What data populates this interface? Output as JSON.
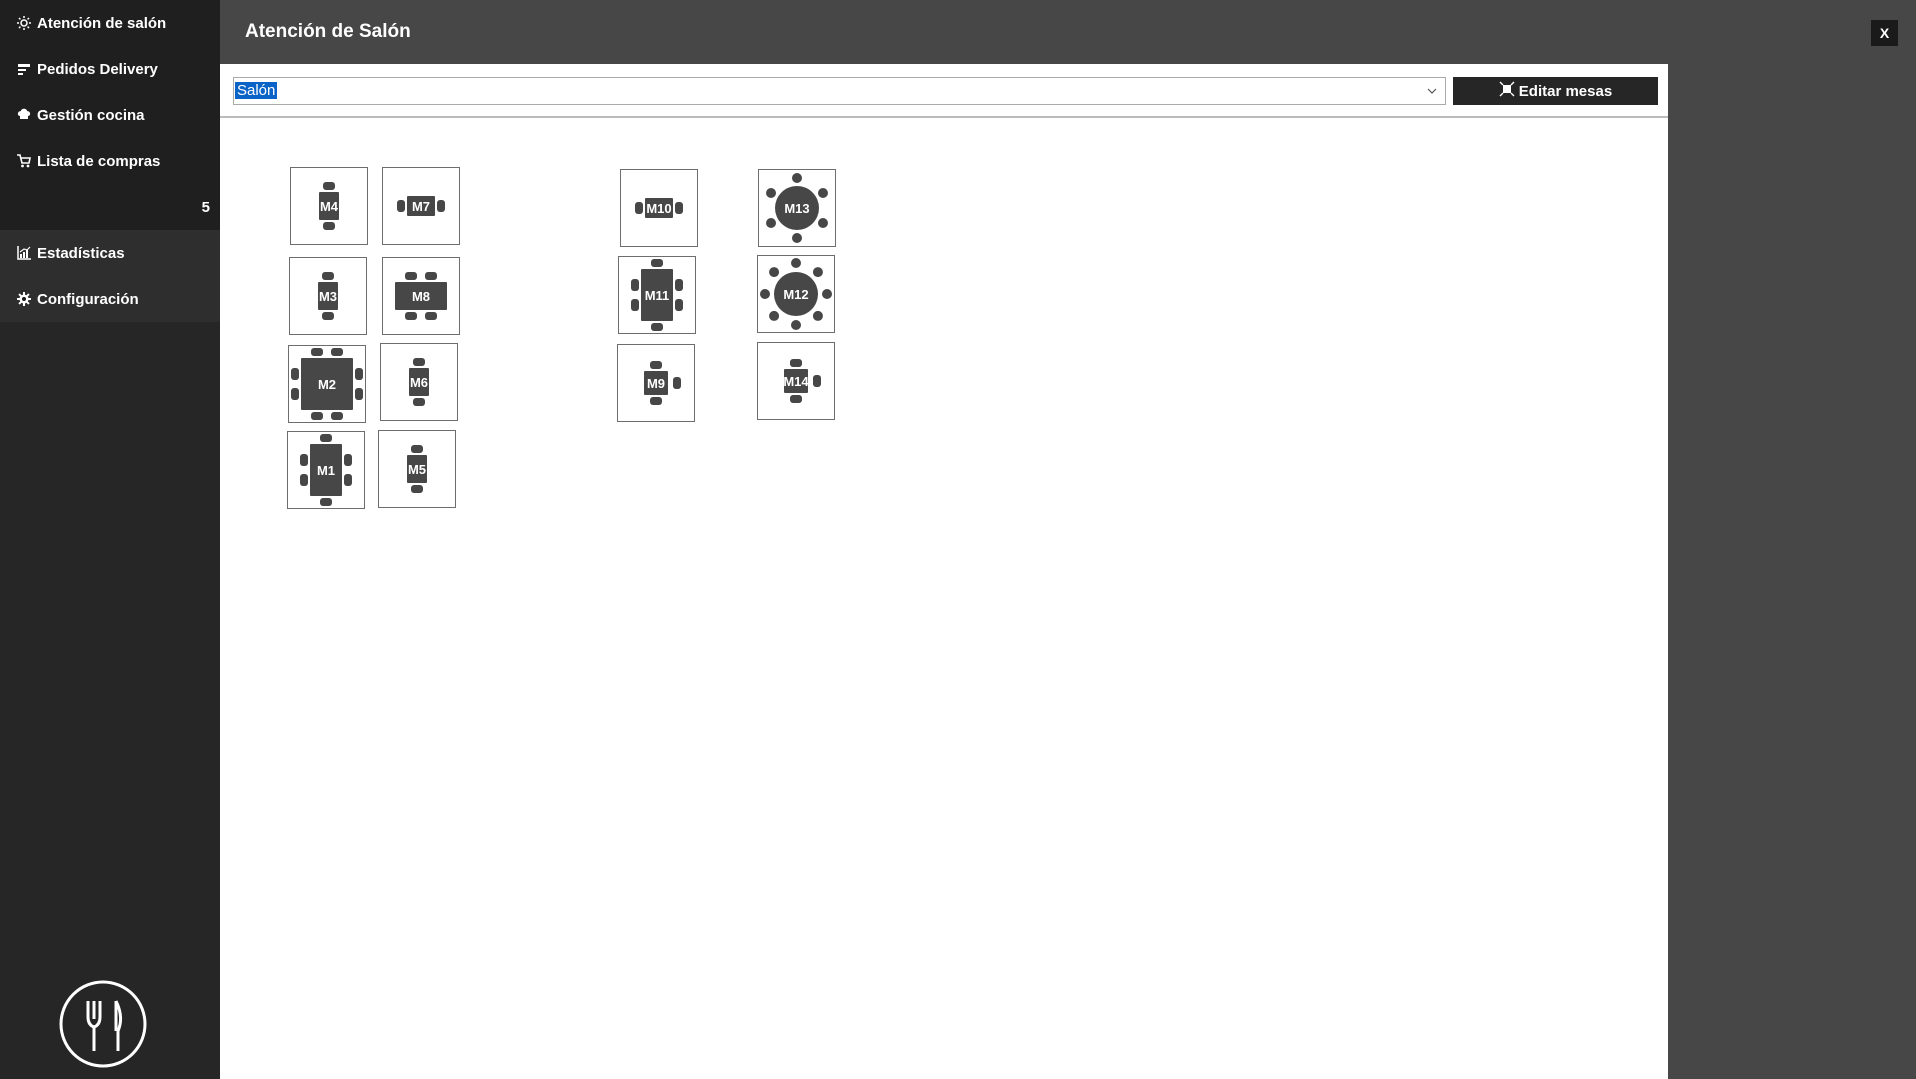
{
  "sidebar": {
    "items": [
      {
        "label": "Atención de salón",
        "icon": "sun-icon"
      },
      {
        "label": "Pedidos Delivery",
        "icon": "delivery-icon"
      },
      {
        "label": "Gestión cocina",
        "icon": "chef-hat-icon"
      },
      {
        "label": "Lista de compras",
        "icon": "cart-icon"
      }
    ],
    "count": "5",
    "items2": [
      {
        "label": "Estadísticas",
        "icon": "chart-icon"
      },
      {
        "label": "Configuración",
        "icon": "gear-icon"
      }
    ]
  },
  "header": {
    "title": "Atención de Salón",
    "close_label": "X"
  },
  "toolbar": {
    "area_selected": "Salón",
    "edit_label": "Editar mesas"
  },
  "colors": {
    "table": "#474747",
    "sidebar": "#262626",
    "header": "#474747",
    "selection": "#0a64c8"
  },
  "tables": [
    {
      "label": "M4",
      "shape": "rect-1x2"
    },
    {
      "label": "M7",
      "shape": "rect-2x1"
    },
    {
      "label": "M3",
      "shape": "rect-1x2"
    },
    {
      "label": "M8",
      "shape": "rect-2x4"
    },
    {
      "label": "M2",
      "shape": "square-8"
    },
    {
      "label": "M6",
      "shape": "rect-1x2"
    },
    {
      "label": "M1",
      "shape": "long-6"
    },
    {
      "label": "M5",
      "shape": "rect-1x2"
    },
    {
      "label": "M10",
      "shape": "rect-2x1"
    },
    {
      "label": "M11",
      "shape": "long-6"
    },
    {
      "label": "M9",
      "shape": "rect-3"
    },
    {
      "label": "M13",
      "shape": "round-6"
    },
    {
      "label": "M12",
      "shape": "round-8"
    },
    {
      "label": "M14",
      "shape": "rect-3"
    }
  ]
}
